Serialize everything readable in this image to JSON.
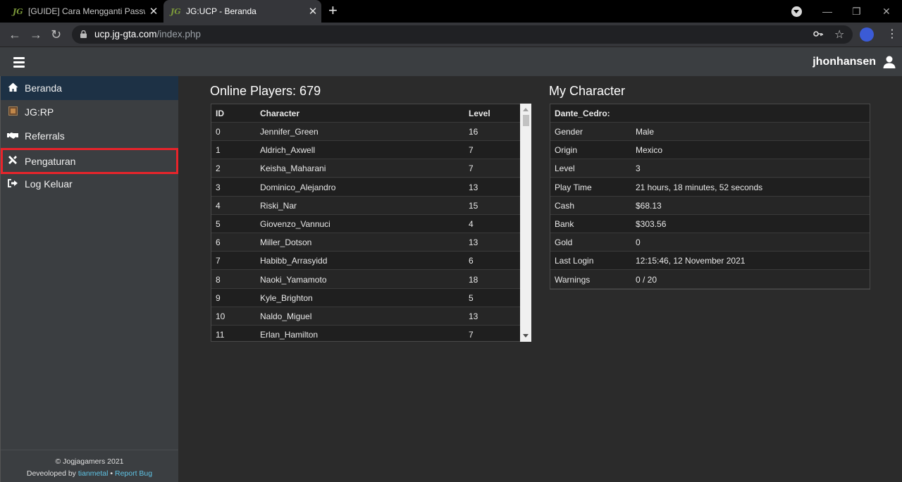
{
  "browser": {
    "tabs": [
      {
        "favicon": "JG",
        "title": "[GUIDE] Cara Mengganti Passwo"
      },
      {
        "favicon": "JG",
        "title": "JG:UCP - Beranda"
      }
    ],
    "url_host": "ucp.jg-gta.com",
    "url_path": "/index.php"
  },
  "header": {
    "username": "jhonhansen"
  },
  "sidebar": {
    "items": [
      {
        "label": "Beranda",
        "icon": "home-icon"
      },
      {
        "label": "JG:RP",
        "icon": "server-icon"
      },
      {
        "label": "Referrals",
        "icon": "handshake-icon"
      },
      {
        "label": "Pengaturan",
        "icon": "tools-icon"
      },
      {
        "label": "Log Keluar",
        "icon": "logout-icon"
      }
    ],
    "footer_line1": "© Jogjagamers 2021",
    "footer_prefix": "Deveoloped by",
    "footer_author": "tianmetal",
    "footer_sep": "•",
    "footer_report": "Report Bug"
  },
  "online": {
    "title": "Online Players: 679",
    "columns": [
      "ID",
      "Character",
      "Level"
    ],
    "rows": [
      [
        "0",
        "Jennifer_Green",
        "16"
      ],
      [
        "1",
        "Aldrich_Axwell",
        "7"
      ],
      [
        "2",
        "Keisha_Maharani",
        "7"
      ],
      [
        "3",
        "Dominico_Alejandro",
        "13"
      ],
      [
        "4",
        "Riski_Nar",
        "15"
      ],
      [
        "5",
        "Giovenzo_Vannuci",
        "4"
      ],
      [
        "6",
        "Miller_Dotson",
        "13"
      ],
      [
        "7",
        "Habibb_Arrasyidd",
        "6"
      ],
      [
        "8",
        "Naoki_Yamamoto",
        "18"
      ],
      [
        "9",
        "Kyle_Brighton",
        "5"
      ],
      [
        "10",
        "Naldo_Miguel",
        "13"
      ],
      [
        "11",
        "Erlan_Hamilton",
        "7"
      ]
    ]
  },
  "character": {
    "title": "My Character",
    "name": "Dante_Cedro:",
    "fields": [
      [
        "Gender",
        "Male"
      ],
      [
        "Origin",
        "Mexico"
      ],
      [
        "Level",
        "3"
      ],
      [
        "Play Time",
        "21 hours, 18 minutes, 52 seconds"
      ],
      [
        "Cash",
        "$68.13"
      ],
      [
        "Bank",
        "$303.56"
      ],
      [
        "Gold",
        "0"
      ],
      [
        "Last Login",
        "12:15:46, 12 November 2021"
      ],
      [
        "Warnings",
        "0 / 20"
      ]
    ]
  }
}
